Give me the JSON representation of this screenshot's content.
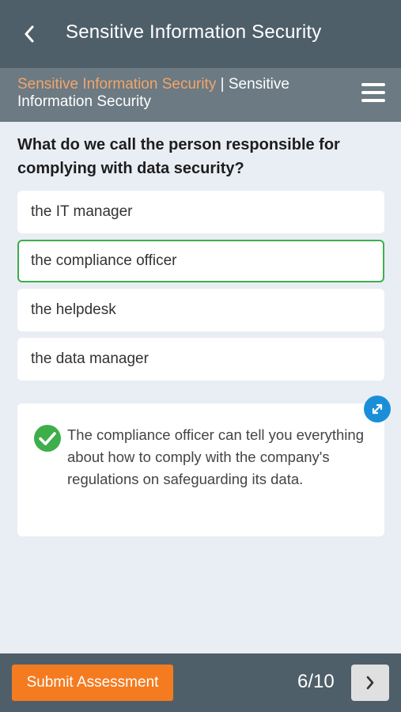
{
  "header": {
    "title": "Sensitive Information Security",
    "back_icon": "chevron-left-icon"
  },
  "subheader": {
    "course": "Sensitive Information Security",
    "separator": " | ",
    "module": "Sensitive Information Security",
    "menu_icon": "hamburger-menu-icon"
  },
  "question": {
    "text": "What do we call the person responsible for complying with data security?"
  },
  "options": [
    {
      "label": "the IT manager",
      "selected": false
    },
    {
      "label": "the compliance officer",
      "selected": true
    },
    {
      "label": "the helpdesk",
      "selected": false
    },
    {
      "label": "the data manager",
      "selected": false
    }
  ],
  "feedback": {
    "text": "The compliance officer can tell you everything about how to comply with the company's regulations on safeguarding its data.",
    "status_icon": "check-circle-icon",
    "expand_icon": "expand-icon"
  },
  "footer": {
    "submit_label": "Submit Assessment",
    "progress": "6/10",
    "next_icon": "chevron-right-icon"
  },
  "colors": {
    "header_bg": "#4f5f69",
    "subheader_bg": "#6b7a83",
    "accent_orange": "#f47b20",
    "course_text": "#f4a56a",
    "correct_green": "#3dae4a",
    "expand_blue": "#1a8fd8",
    "page_bg": "#e9eef4"
  }
}
